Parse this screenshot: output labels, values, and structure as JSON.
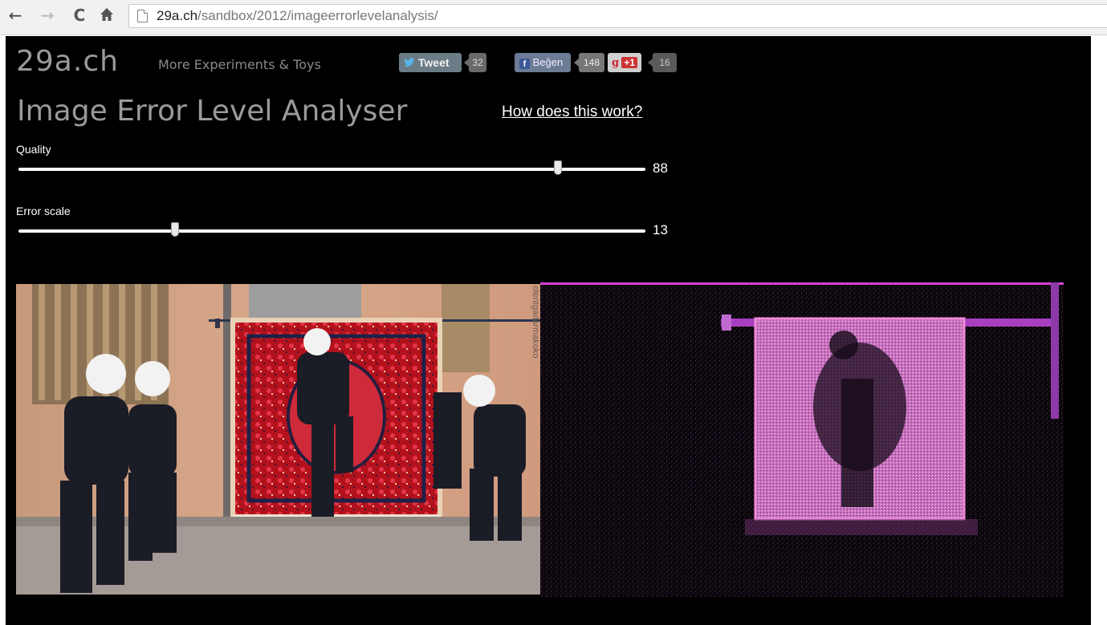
{
  "browser": {
    "url_domain": "29a.ch",
    "url_path": "/sandbox/2012/imageerrorlevelanalysis/"
  },
  "header": {
    "logo": "29a.ch",
    "more_link": "More Experiments & Toys",
    "tweet_label": "Tweet",
    "tweet_count": "32",
    "fb_label": "Beğen",
    "fb_count": "148",
    "gplus_label": "+1",
    "gplus_count": "16"
  },
  "main": {
    "title": "Image Error Level Analyser",
    "how_link": "How does this work?"
  },
  "controls": {
    "quality": {
      "label": "Quality",
      "value": "88",
      "fraction": 0.861
    },
    "error_scale": {
      "label": "Error scale",
      "value": "13",
      "fraction": 0.25
    }
  },
  "images": {
    "watermark": "olentgadarmakoko"
  },
  "colors": {
    "page_bg": "#000000",
    "text": "#ffffff",
    "logo_gray": "#9a9a9a",
    "ela_magenta": "#d63fd6"
  },
  "icons": {
    "back": "back-arrow-icon",
    "forward": "forward-arrow-icon",
    "reload": "reload-icon",
    "home": "home-icon",
    "page": "page-icon",
    "twitter": "twitter-bird-icon",
    "facebook": "facebook-f-icon",
    "gplus": "google-plus-icon"
  }
}
